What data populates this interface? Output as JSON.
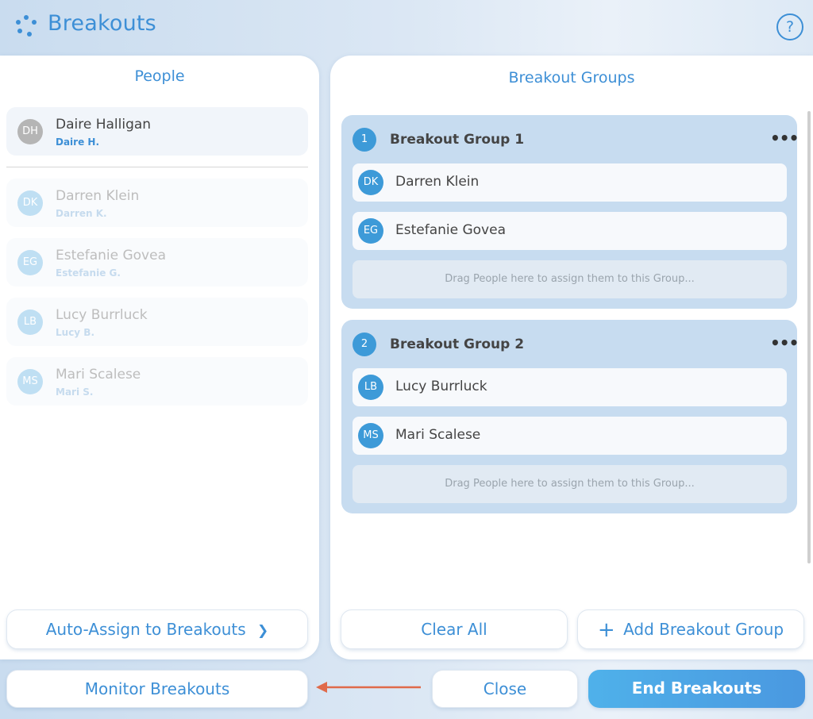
{
  "header": {
    "title": "Breakouts",
    "help_icon": "?"
  },
  "people_panel": {
    "title": "People",
    "unassigned": [
      {
        "initials": "DH",
        "name": "Daire Halligan",
        "short": "Daire H."
      }
    ],
    "assigned": [
      {
        "initials": "DK",
        "name": "Darren Klein",
        "short": "Darren K."
      },
      {
        "initials": "EG",
        "name": "Estefanie Govea",
        "short": "Estefanie G."
      },
      {
        "initials": "LB",
        "name": "Lucy Burrluck",
        "short": "Lucy B."
      },
      {
        "initials": "MS",
        "name": "Mari Scalese",
        "short": "Mari S."
      }
    ],
    "auto_assign_label": "Auto-Assign to Breakouts",
    "auto_assign_chevron": "❯"
  },
  "groups_panel": {
    "title": "Breakout Groups",
    "groups": [
      {
        "number": "1",
        "title": "Breakout Group 1",
        "menu": "•••",
        "members": [
          {
            "initials": "DK",
            "name": "Darren Klein"
          },
          {
            "initials": "EG",
            "name": "Estefanie Govea"
          }
        ],
        "drop_hint": "Drag People here to assign them to this Group..."
      },
      {
        "number": "2",
        "title": "Breakout Group 2",
        "menu": "•••",
        "members": [
          {
            "initials": "LB",
            "name": "Lucy Burrluck"
          },
          {
            "initials": "MS",
            "name": "Mari Scalese"
          }
        ],
        "drop_hint": "Drag People here to assign them to this Group..."
      }
    ],
    "clear_all_label": "Clear All",
    "add_group_icon": "+",
    "add_group_label": "Add Breakout Group"
  },
  "footer": {
    "monitor_label": "Monitor Breakouts",
    "close_label": "Close",
    "end_label": "End Breakouts"
  },
  "colors": {
    "accent": "#3d8fd6",
    "avatar_blue": "#3d9ad8",
    "group_bg": "#c7dcf0",
    "end_button": "#4aa8e6",
    "arrow": "#e06a4a"
  }
}
